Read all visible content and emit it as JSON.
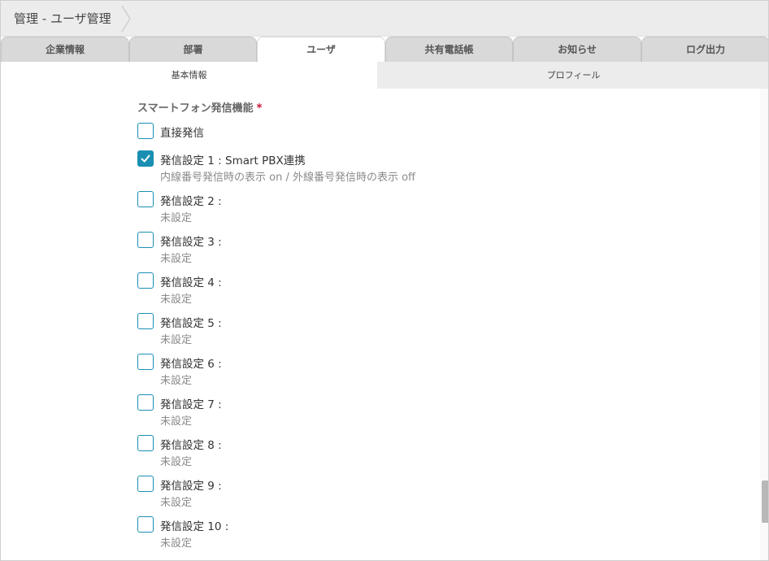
{
  "breadcrumb": {
    "current": "管理 - ユーザ管理"
  },
  "tabs": [
    "企業情報",
    "部署",
    "ユーザ",
    "共有電話帳",
    "お知らせ",
    "ログ出力"
  ],
  "active_tab": "ユーザ",
  "subtabs": [
    "基本情報",
    "プロフィール"
  ],
  "active_subtab": "基本情報",
  "section": {
    "title": "スマートフォン発信機能",
    "required_mark": "*"
  },
  "options": [
    {
      "label": "直接発信",
      "sub": "",
      "checked": false
    },
    {
      "label": "発信設定 1 : Smart PBX連携",
      "sub": "内線番号発信時の表示 on / 外線番号発信時の表示 off",
      "checked": true
    },
    {
      "label": "発信設定 2 :",
      "sub": "未設定",
      "checked": false
    },
    {
      "label": "発信設定 3 :",
      "sub": "未設定",
      "checked": false
    },
    {
      "label": "発信設定 4 :",
      "sub": "未設定",
      "checked": false
    },
    {
      "label": "発信設定 5 :",
      "sub": "未設定",
      "checked": false
    },
    {
      "label": "発信設定 6 :",
      "sub": "未設定",
      "checked": false
    },
    {
      "label": "発信設定 7 :",
      "sub": "未設定",
      "checked": false
    },
    {
      "label": "発信設定 8 :",
      "sub": "未設定",
      "checked": false
    },
    {
      "label": "発信設定 9 :",
      "sub": "未設定",
      "checked": false
    },
    {
      "label": "発信設定 10 :",
      "sub": "未設定",
      "checked": false
    }
  ],
  "colors": {
    "accent": "#1a8fb3",
    "required": "#c8102e"
  },
  "icons": {
    "breadcrumb_separator": "chevron-right-icon",
    "checkmark": "check-icon"
  }
}
